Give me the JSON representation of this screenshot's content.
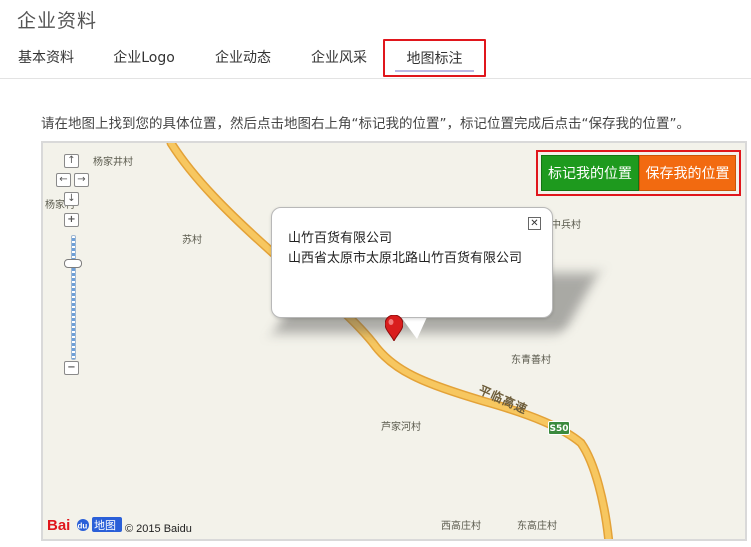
{
  "page": {
    "title": "企业资料"
  },
  "tabs": [
    {
      "label": "基本资料"
    },
    {
      "label": "企业Logo"
    },
    {
      "label": "企业动态"
    },
    {
      "label": "企业风采"
    },
    {
      "label": "地图标注",
      "active": true
    }
  ],
  "instruction": "请在地图上找到您的具体位置，然后点击地图右上角“标记我的位置”，标记位置完成后点击“保存我的位置”。",
  "map": {
    "buttons": {
      "mark": "标记我的位置",
      "save": "保存我的位置"
    },
    "popup": {
      "title": "山竹百货有限公司",
      "address": "山西省太原市太原北路山竹百货有限公司",
      "close_icon": "close-icon"
    },
    "places": {
      "yangjiajing": "杨家井村",
      "yangjia": "杨家村",
      "su": "苏村",
      "zhongbing": "中兵村",
      "dongqingshan": "东青善村",
      "lujiahe": "芦家河村",
      "xigaozhuang": "西高庄村",
      "donggaozhuang": "东高庄村"
    },
    "road_label": "平临高速",
    "shield": "S50",
    "zoom": {
      "up": "↑",
      "left": "←",
      "right": "→",
      "down": "↓",
      "plus": "+",
      "minus": "−"
    },
    "logo": {
      "bai": "Bai",
      "du": "du",
      "ditu": "地图"
    },
    "copyright": "© 2015 Baidu",
    "colors": {
      "road": "#f5b94a",
      "marker": "#e02020",
      "land": "#f3f2ea"
    }
  }
}
